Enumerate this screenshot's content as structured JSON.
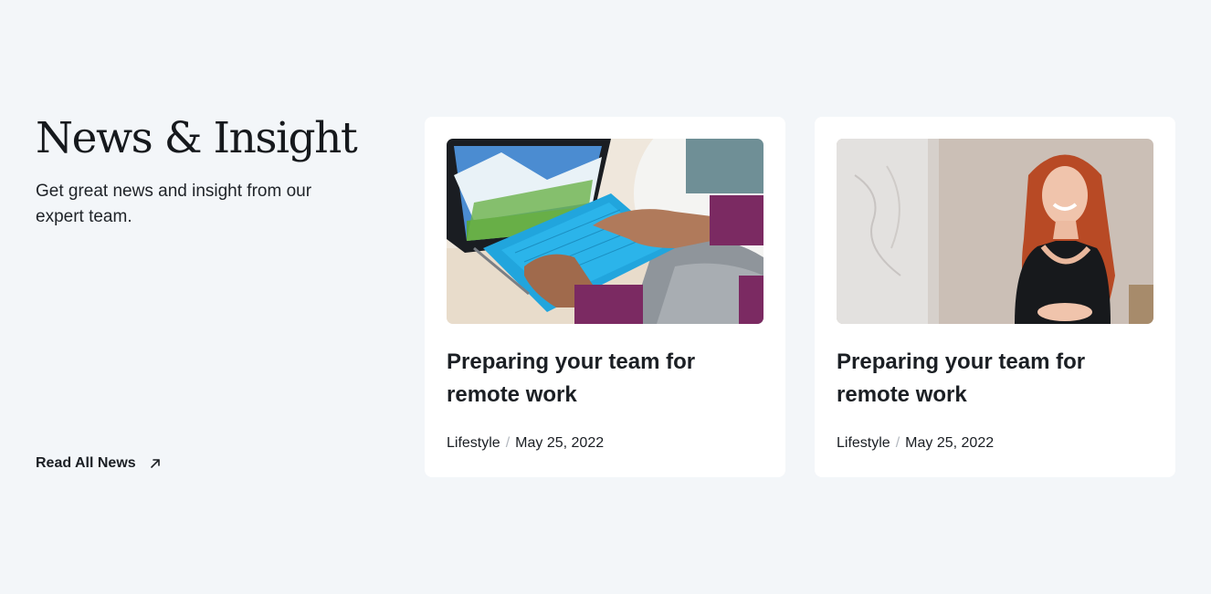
{
  "section": {
    "title": "News & Insight",
    "subtitle": "Get great news and insight from our expert team.",
    "read_all_label": "Read All News",
    "read_all_icon": "arrow-up-right-icon"
  },
  "articles": [
    {
      "title": "Preparing your team for remote work",
      "category": "Lifestyle",
      "separator": "/",
      "date": "May 25, 2022",
      "image": "laptop-typing-photo"
    },
    {
      "title": "Preparing your team for remote work",
      "category": "Lifestyle",
      "separator": "/",
      "date": "May 25, 2022",
      "image": "smiling-woman-photo"
    }
  ],
  "colors": {
    "background": "#f3f6f9",
    "card": "#ffffff",
    "text": "#1b1f24",
    "separator": "#b3b8bf"
  }
}
